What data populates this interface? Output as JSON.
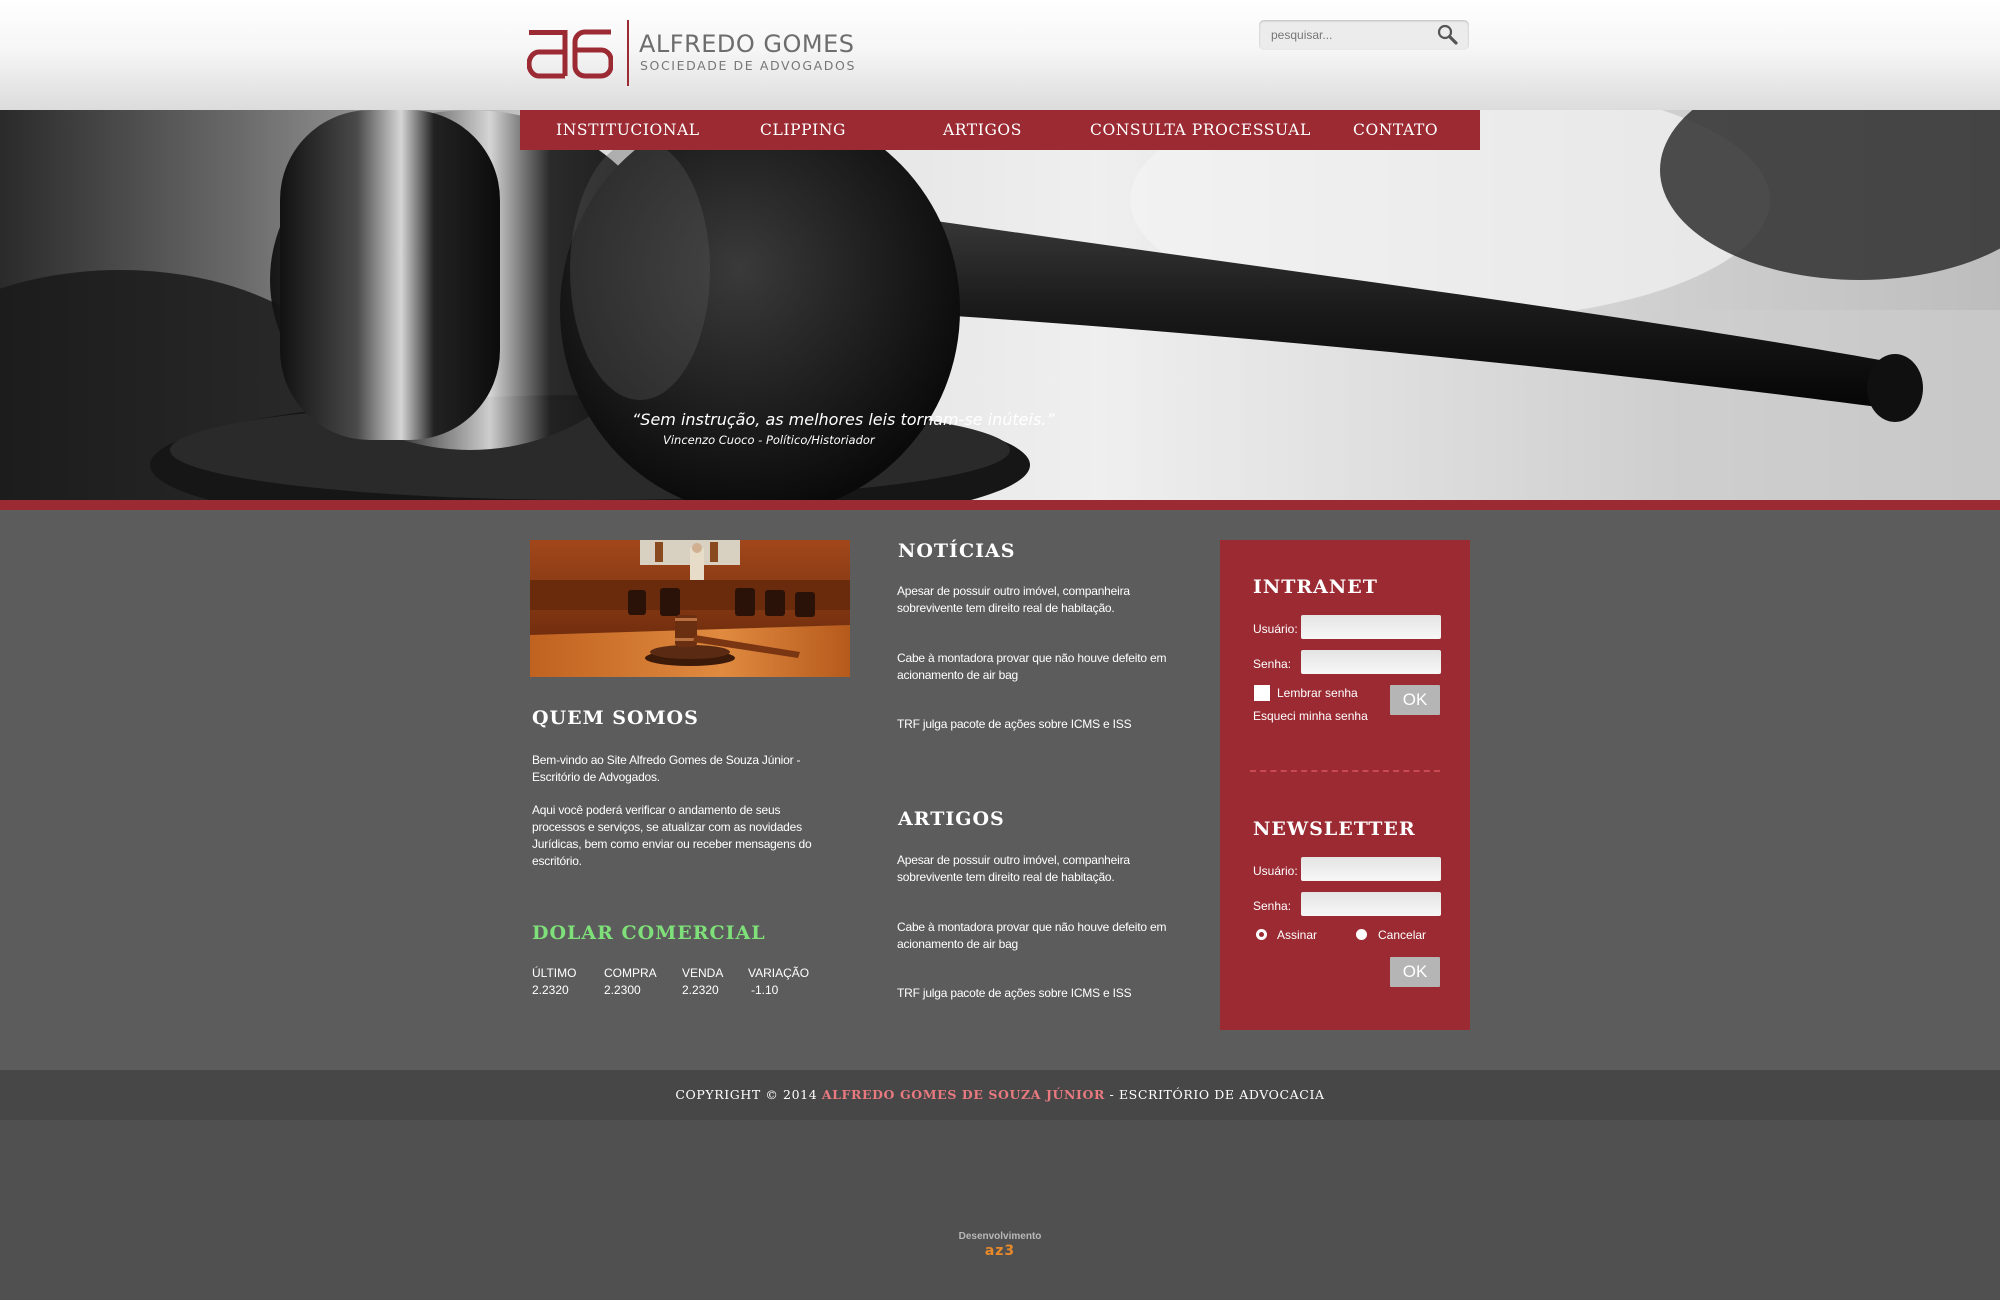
{
  "brand": {
    "name": "ALFREDO GOMES",
    "subtitle": "SOCIEDADE DE ADVOGADOS",
    "color": "#9b2a33"
  },
  "search": {
    "placeholder": "pesquisar...",
    "icon": "search-icon"
  },
  "nav": {
    "items": [
      {
        "label": "INSTITUCIONAL"
      },
      {
        "label": "CLIPPING"
      },
      {
        "label": "ARTIGOS"
      },
      {
        "label": "CONSULTA  PROCESSUAL"
      },
      {
        "label": "CONTATO"
      }
    ]
  },
  "hero": {
    "quote": "“Sem instrução, as melhores leis tornam-se inúteis.”",
    "author": "Vincenzo Cuoco - Político/Historiador"
  },
  "about": {
    "title": "QUEM SOMOS",
    "paragraph1": "Bem-vindo ao Site  Alfredo Gomes de Souza Júnior - Escritório de Advogados.",
    "paragraph2": "Aqui você poderá verificar o andamento de seus processos e serviços, se atualizar com as novidades Jurídicas, bem como enviar ou receber mensagens do escritório."
  },
  "dolar": {
    "title": "DOLAR COMERCIAL",
    "title_color": "#7fe07a",
    "columns": [
      {
        "header": "ÚLTIMO",
        "value": "2.2320"
      },
      {
        "header": "COMPRA",
        "value": "2.2300"
      },
      {
        "header": "VENDA",
        "value": "2.2320"
      },
      {
        "header": "VARIAÇÃO",
        "value": "-1.10"
      }
    ]
  },
  "news": {
    "title": "NOTÍCIAS",
    "items": [
      {
        "text": "Apesar de possuir outro imóvel, companheira sobrevivente tem direito real de habitação."
      },
      {
        "text": "Cabe à montadora provar que não houve defeito em acionamento de air bag"
      },
      {
        "text": "TRF julga pacote de ações sobre ICMS e ISS"
      }
    ]
  },
  "articles": {
    "title": "ARTIGOS",
    "items": [
      {
        "text": "Apesar de possuir outro imóvel, companheira sobrevivente tem direito real de habitação."
      },
      {
        "text": "Cabe à montadora provar que não houve defeito em acionamento de air bag"
      },
      {
        "text": "TRF julga pacote de ações sobre ICMS e ISS"
      }
    ]
  },
  "intranet": {
    "title": "INTRANET",
    "user_label": "Usuário:",
    "pass_label": "Senha:",
    "remember_label": "Lembrar senha",
    "forgot_label": "Esqueci minha senha",
    "ok_label": "OK"
  },
  "newsletter": {
    "title": "NEWSLETTER",
    "user_label": "Usuário:",
    "pass_label": "Senha:",
    "subscribe_label": "Assinar",
    "cancel_label": "Cancelar",
    "ok_label": "OK"
  },
  "footer": {
    "prefix": "COPYRIGHT © 2014 ",
    "highlight": "ALFREDO GOMES DE SOUZA JÚNIOR",
    "suffix": " - ESCRITÓRIO DE ADVOCACIA",
    "dev_label": "Desenvolvimento",
    "dev_logo": "az3"
  }
}
